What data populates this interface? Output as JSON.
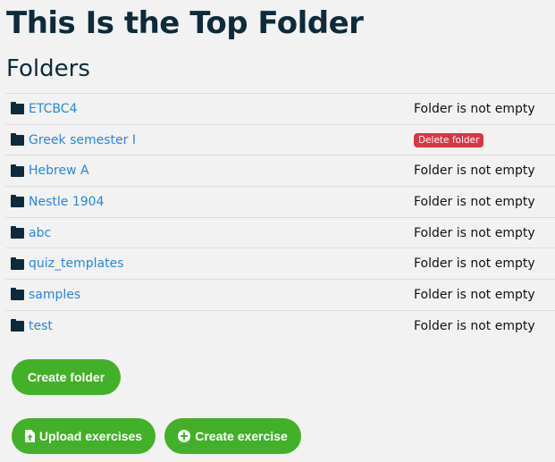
{
  "title": "This Is the Top Folder",
  "section": "Folders",
  "folders": [
    {
      "name": "ETCBC4",
      "status": "Folder is not empty"
    },
    {
      "name": "Greek semester I",
      "action": "Delete folder"
    },
    {
      "name": "Hebrew A",
      "status": "Folder is not empty"
    },
    {
      "name": "Nestle 1904",
      "status": "Folder is not empty"
    },
    {
      "name": "abc",
      "status": "Folder is not empty"
    },
    {
      "name": "quiz_templates",
      "status": "Folder is not empty"
    },
    {
      "name": "samples",
      "status": "Folder is not empty"
    },
    {
      "name": "test",
      "status": "Folder is not empty"
    }
  ],
  "buttons": {
    "create_folder": "Create folder",
    "upload": "Upload exercises",
    "create_exercise": "Create exercise"
  }
}
